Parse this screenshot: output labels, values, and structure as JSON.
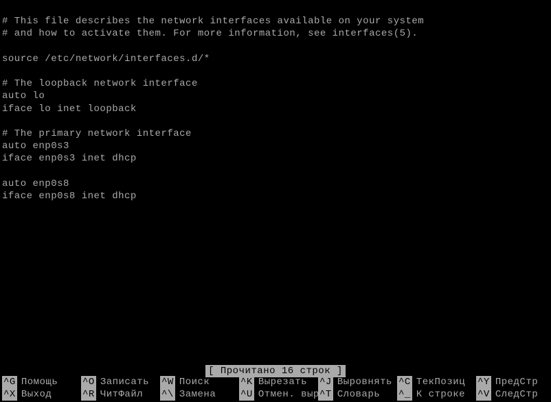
{
  "content": {
    "lines": [
      "# This file describes the network interfaces available on your system",
      "# and how to activate them. For more information, see interfaces(5).",
      "",
      "source /etc/network/interfaces.d/*",
      "",
      "# The loopback network interface",
      "auto lo",
      "iface lo inet loopback",
      "",
      "# The primary network interface",
      "auto enp0s3",
      "iface enp0s3 inet dhcp",
      "",
      "auto enp0s8",
      "iface enp0s8 inet dhcp"
    ]
  },
  "status": {
    "message": "[ Прочитано 16 строк ]"
  },
  "shortcuts": {
    "row1": [
      {
        "key": "^G",
        "label": "Помощь"
      },
      {
        "key": "^O",
        "label": "Записать"
      },
      {
        "key": "^W",
        "label": "Поиск"
      },
      {
        "key": "^K",
        "label": "Вырезать"
      },
      {
        "key": "^J",
        "label": "Выровнять"
      },
      {
        "key": "^C",
        "label": "ТекПозиц"
      },
      {
        "key": "^Y",
        "label": "ПредСтр"
      }
    ],
    "row2": [
      {
        "key": "^X",
        "label": "Выход"
      },
      {
        "key": "^R",
        "label": "ЧитФайл"
      },
      {
        "key": "^\\",
        "label": "Замена"
      },
      {
        "key": "^U",
        "label": "Отмен. выре"
      },
      {
        "key": "^T",
        "label": "Словарь"
      },
      {
        "key": "^_",
        "label": "К строке"
      },
      {
        "key": "^V",
        "label": "СледСтр"
      }
    ]
  }
}
